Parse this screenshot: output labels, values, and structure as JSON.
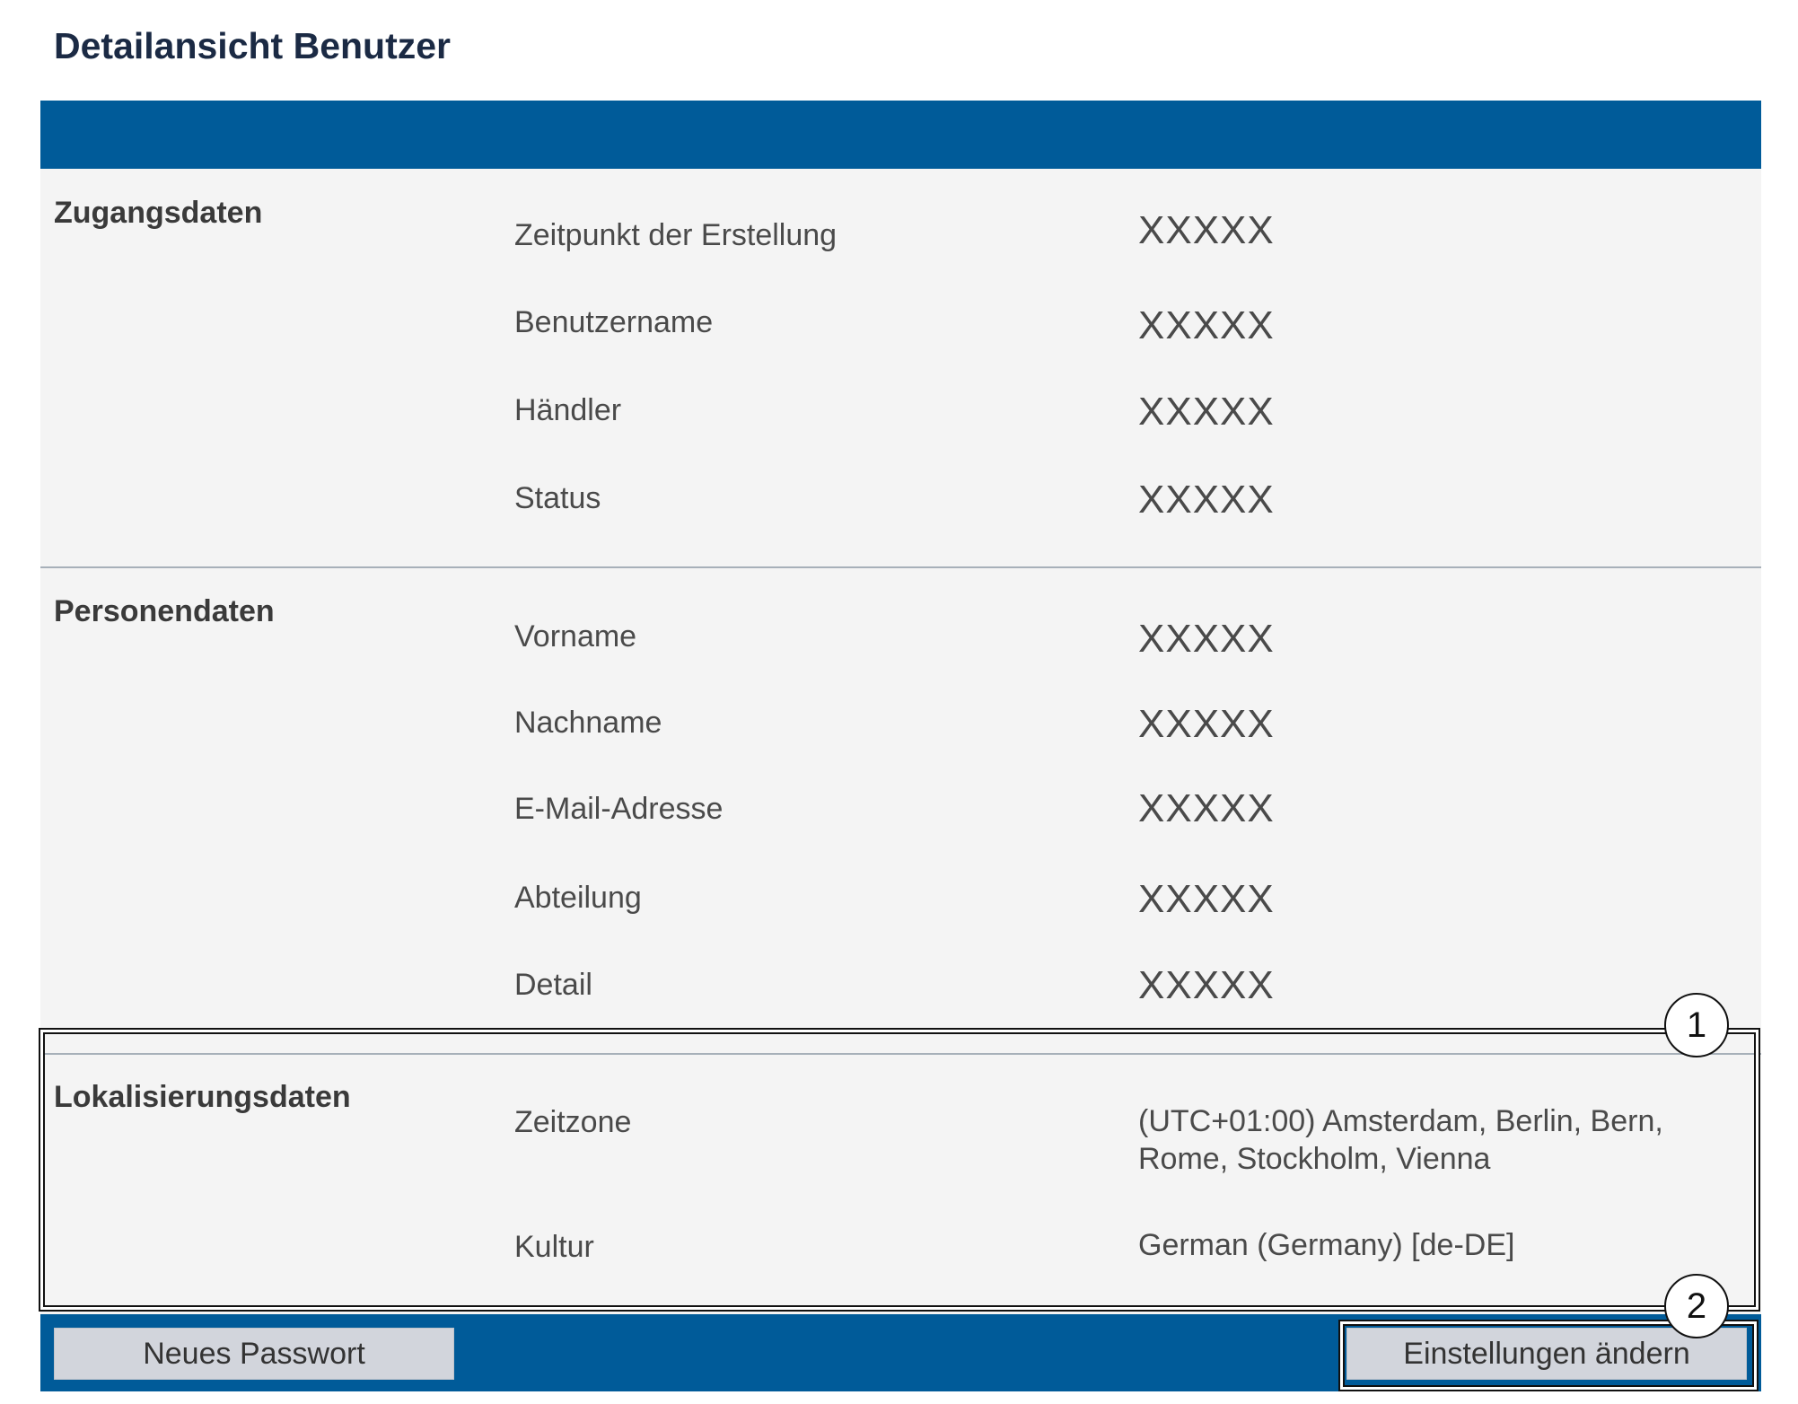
{
  "page_title": "Detailansicht Benutzer",
  "sections": {
    "zugang": {
      "title": "Zugangsdaten",
      "fields": [
        {
          "label": "Zeitpunkt der Erstellung",
          "value": "XXXXX"
        },
        {
          "label": "Benutzername",
          "value": "XXXXX"
        },
        {
          "label": "Händler",
          "value": "XXXXX"
        },
        {
          "label": "Status",
          "value": "XXXXX"
        }
      ]
    },
    "person": {
      "title": "Personendaten",
      "fields": [
        {
          "label": "Vorname",
          "value": "XXXXX"
        },
        {
          "label": "Nachname",
          "value": "XXXXX"
        },
        {
          "label": "E-Mail-Adresse",
          "value": "XXXXX"
        },
        {
          "label": "Abteilung",
          "value": "XXXXX"
        },
        {
          "label": "Detail",
          "value": "XXXXX"
        }
      ]
    },
    "lokal": {
      "title": "Lokalisierungsdaten",
      "fields": [
        {
          "label": "Zeitzone",
          "value": "(UTC+01:00) Amsterdam, Berlin, Bern, Rome, Stockholm, Vienna"
        },
        {
          "label": "Kultur",
          "value": "German (Germany) [de-DE]"
        }
      ]
    }
  },
  "buttons": {
    "new_password": "Neues Passwort",
    "change_settings": "Einstellungen ändern"
  },
  "callouts": [
    "1",
    "2"
  ],
  "colors": {
    "header_bar": "#005b99",
    "panel_bg": "#f4f4f4",
    "button_bg": "#d2d5dc",
    "title_text": "#1b2a44"
  }
}
